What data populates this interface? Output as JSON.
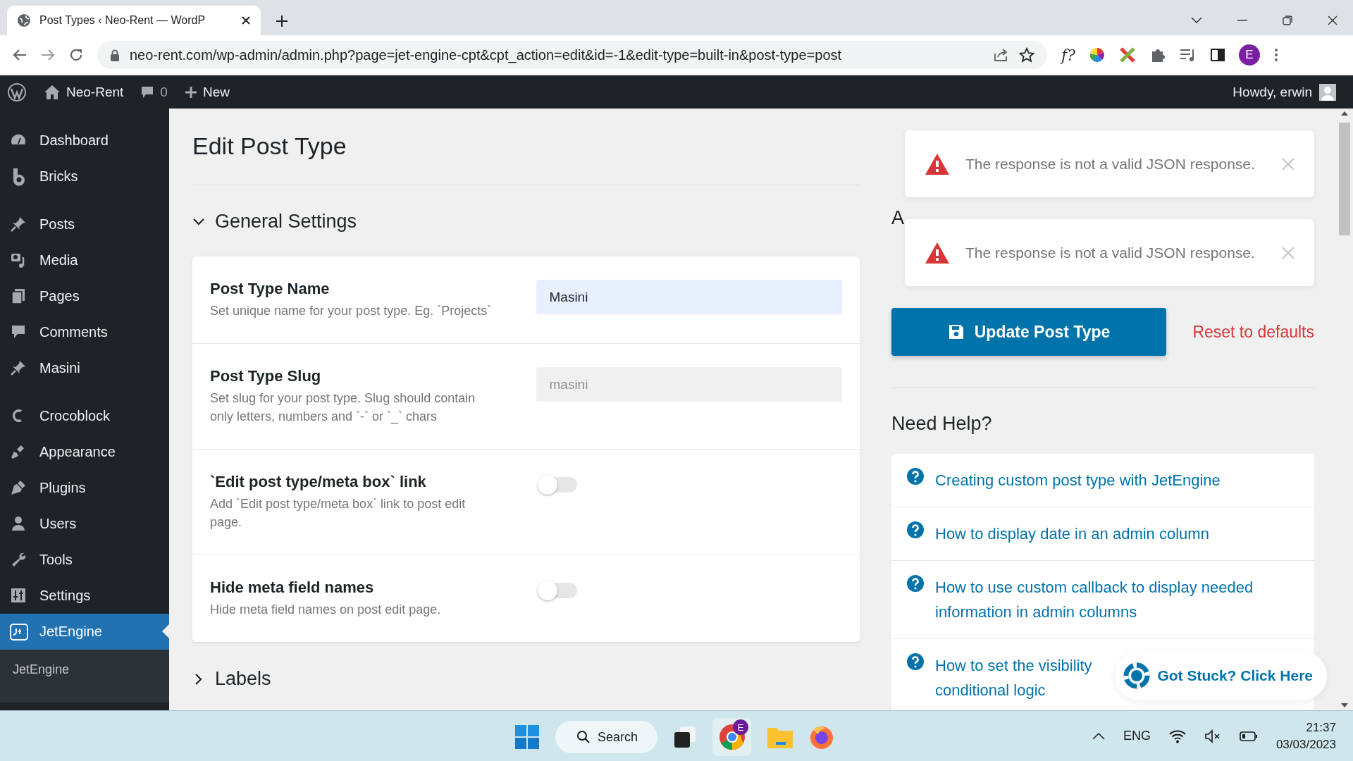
{
  "browser": {
    "tab_title": "Post Types ‹ Neo-Rent — WordP",
    "url": "neo-rent.com/wp-admin/admin.php?page=jet-engine-cpt&cpt_action=edit&id=-1&edit-type=built-in&post-type=post",
    "ext_text": "f?",
    "profile": "E"
  },
  "admin_bar": {
    "site": "Neo-Rent",
    "comments": "0",
    "new": "New",
    "greeting": "Howdy, erwin"
  },
  "sidebar": {
    "sections": [
      {
        "items": [
          {
            "label": "Dashboard",
            "selected": false
          },
          {
            "label": "Bricks",
            "selected": false
          }
        ]
      },
      {
        "items": [
          {
            "label": "Posts",
            "selected": false
          },
          {
            "label": "Media",
            "selected": false
          },
          {
            "label": "Pages",
            "selected": false
          },
          {
            "label": "Comments",
            "selected": false
          },
          {
            "label": "Masini",
            "selected": false
          }
        ]
      },
      {
        "items": [
          {
            "label": "Crocoblock",
            "selected": false
          },
          {
            "label": "Appearance",
            "selected": false
          },
          {
            "label": "Plugins",
            "selected": false
          },
          {
            "label": "Users",
            "selected": false
          },
          {
            "label": "Tools",
            "selected": false
          },
          {
            "label": "Settings",
            "selected": false
          },
          {
            "label": "JetEngine",
            "selected": true,
            "submenu": [
              {
                "label": "JetEngine"
              }
            ]
          }
        ]
      }
    ]
  },
  "page": {
    "title": "Edit Post Type",
    "sections": [
      {
        "title": "General Settings",
        "expanded": true,
        "fields": [
          {
            "kind": "text",
            "label": "Post Type Name",
            "description": "Set unique name for your post type. Eg. `Projects`",
            "value": "Masini"
          },
          {
            "kind": "text",
            "label": "Post Type Slug",
            "description": "Set slug for your post type. Slug should contain only letters, numbers and `-` or `_` chars",
            "placeholder": "masini"
          },
          {
            "kind": "toggle",
            "label": "`Edit post type/meta box` link",
            "description": "Add `Edit post type/meta box` link to post edit page.",
            "on": false
          },
          {
            "kind": "toggle",
            "label": "Hide meta field names",
            "description": "Hide meta field names on post edit page.",
            "on": false
          }
        ]
      },
      {
        "title": "Labels",
        "expanded": false
      }
    ]
  },
  "actions": {
    "title": "A",
    "update_button": "Update Post Type",
    "reset_link": "Reset to defaults"
  },
  "help": {
    "title": "Need Help?",
    "links": [
      "Creating custom post type with JetEngine",
      "How to display date in an admin column",
      "How to use custom callback to display needed information in admin columns",
      "How to set the visibility conditional logic"
    ]
  },
  "toasts": [
    {
      "message": "The response is not a valid JSON response."
    },
    {
      "message": "The response is not a valid JSON response."
    }
  ],
  "got_stuck": "Got Stuck? Click Here",
  "taskbar": {
    "search": "Search",
    "chrome_badge": "E",
    "language": "ENG",
    "time": "21:37",
    "date": "03/03/2023"
  }
}
